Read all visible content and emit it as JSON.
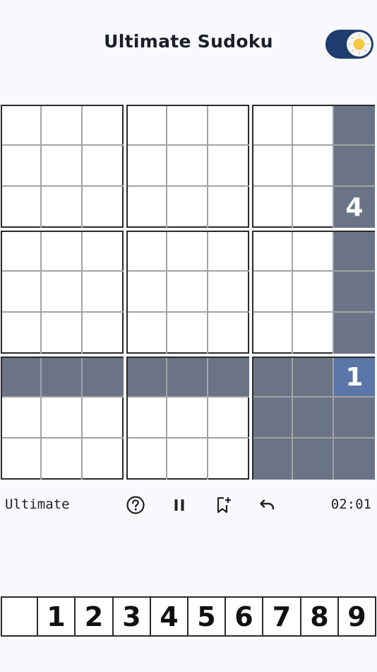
{
  "header": {
    "title": "Ultimate Sudoku",
    "theme_toggle": {
      "state": "on",
      "icon": "sun-icon",
      "track_color": "#1f3d6e",
      "sun_color": "#f7c744"
    }
  },
  "board": {
    "highlight_color": "#6b7486",
    "selected_color": "#5a76a8",
    "cells": [
      [
        "",
        "",
        "",
        "",
        "",
        "",
        "",
        "",
        ""
      ],
      [
        "",
        "",
        "",
        "",
        "",
        "",
        "",
        "",
        ""
      ],
      [
        "",
        "",
        "",
        "",
        "",
        "",
        "",
        "",
        "4"
      ],
      [
        "",
        "",
        "",
        "",
        "",
        "",
        "",
        "",
        ""
      ],
      [
        "",
        "",
        "",
        "",
        "",
        "",
        "",
        "",
        ""
      ],
      [
        "",
        "",
        "",
        "",
        "",
        "",
        "",
        "",
        ""
      ],
      [
        "",
        "",
        "",
        "",
        "",
        "",
        "",
        "",
        "1"
      ],
      [
        "",
        "",
        "",
        "",
        "",
        "",
        "",
        "",
        ""
      ],
      [
        "",
        "",
        "",
        "",
        "",
        "",
        "",
        "",
        ""
      ]
    ],
    "selected": {
      "row": 7,
      "col": 9
    }
  },
  "toolbar": {
    "difficulty": "Ultimate",
    "timer": "02:01",
    "tools": [
      "help-icon",
      "pause-icon",
      "bookmark-add-icon",
      "undo-icon"
    ]
  },
  "numpad": {
    "keys": [
      "",
      "1",
      "2",
      "3",
      "4",
      "5",
      "6",
      "7",
      "8",
      "9"
    ]
  }
}
